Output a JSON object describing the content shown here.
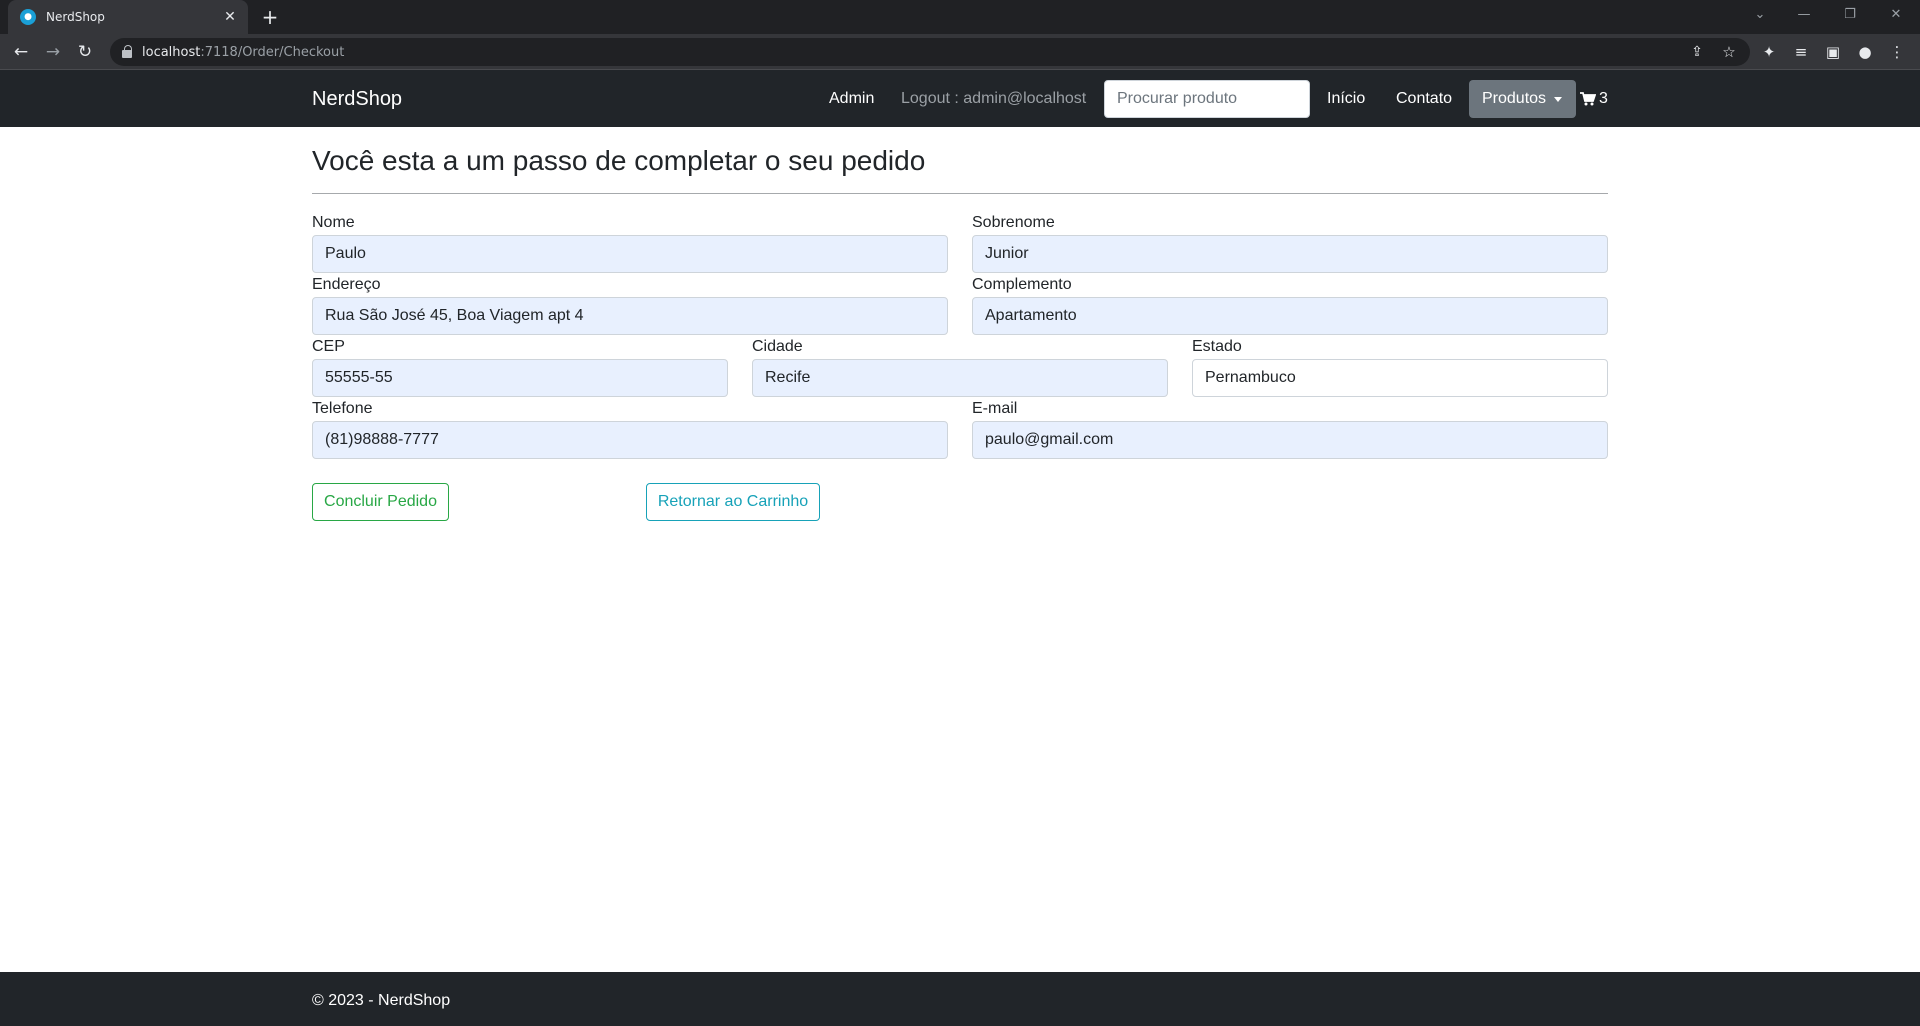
{
  "browser": {
    "tab_title": "NerdShop",
    "url_host": "localhost",
    "url_path": ":7118/Order/Checkout"
  },
  "navbar": {
    "brand": "NerdShop",
    "admin": "Admin",
    "logout": "Logout : admin@localhost",
    "search_placeholder": "Procurar produto",
    "inicio": "Início",
    "contato": "Contato",
    "produtos": "Produtos",
    "cart_count": "3"
  },
  "page": {
    "title": "Você esta a um passo de completar o seu pedido"
  },
  "form": {
    "nome": {
      "label": "Nome",
      "value": "Paulo"
    },
    "sobrenome": {
      "label": "Sobrenome",
      "value": "Junior"
    },
    "endereco": {
      "label": "Endereço",
      "value": "Rua São José 45, Boa Viagem apt 4"
    },
    "complemento": {
      "label": "Complemento",
      "value": "Apartamento"
    },
    "cep": {
      "label": "CEP",
      "value": "55555-55"
    },
    "cidade": {
      "label": "Cidade",
      "value": "Recife"
    },
    "estado": {
      "label": "Estado",
      "value": "Pernambuco"
    },
    "telefone": {
      "label": "Telefone",
      "value": "(81)98888-7777"
    },
    "email": {
      "label": "E-mail",
      "value": "paulo@gmail.com"
    }
  },
  "actions": {
    "concluir": "Concluir Pedido",
    "retornar": "Retornar ao Carrinho"
  },
  "footer": {
    "text": "© 2023 - NerdShop"
  },
  "colors": {
    "navbar_bg": "#212529",
    "autofill_bg": "#e8f0fe",
    "success": "#28a745",
    "info": "#17a2b8",
    "secondary": "#6c757d"
  }
}
